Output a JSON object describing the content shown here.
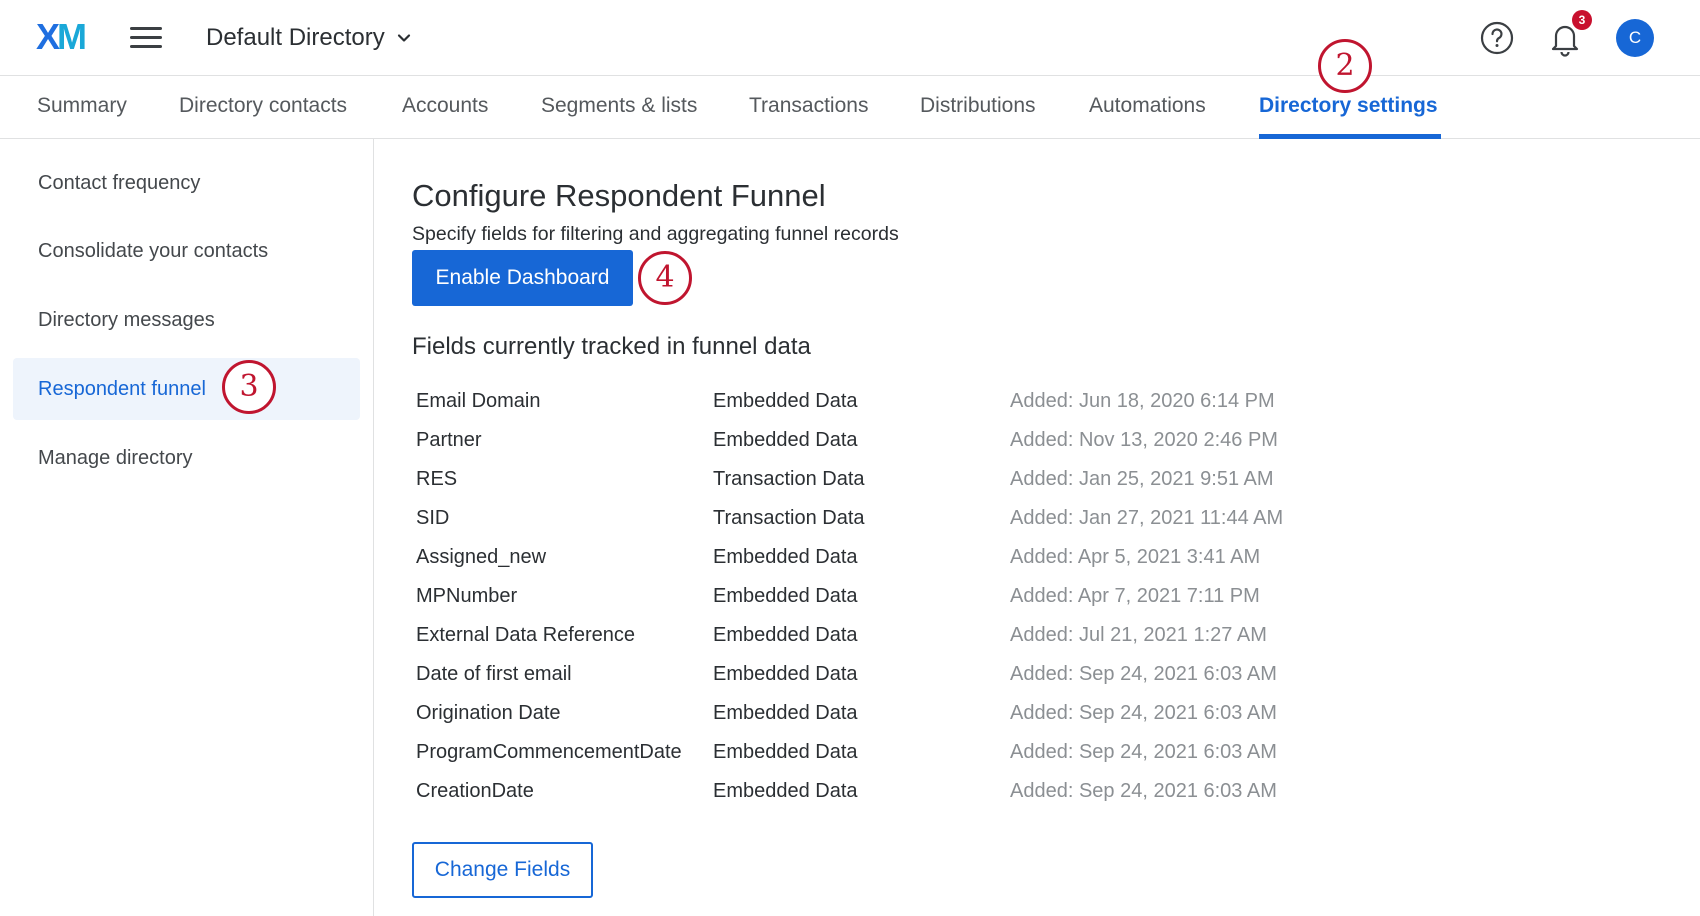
{
  "header": {
    "logo_x": "X",
    "logo_m": "M",
    "menu_icon": "hamburger-menu-icon",
    "directory_label": "Default Directory",
    "notification_count": "3",
    "avatar_initial": "C",
    "help_icon": "help-circle-icon",
    "bell_icon": "bell-icon"
  },
  "tabs": [
    {
      "label": "Summary"
    },
    {
      "label": "Directory contacts"
    },
    {
      "label": "Accounts"
    },
    {
      "label": "Segments & lists"
    },
    {
      "label": "Transactions"
    },
    {
      "label": "Distributions"
    },
    {
      "label": "Automations"
    },
    {
      "label": "Directory settings",
      "active": true
    }
  ],
  "callouts": {
    "tab": "2",
    "sidebar": "3",
    "button": "4"
  },
  "sidebar": {
    "items": [
      {
        "label": "Contact frequency"
      },
      {
        "label": "Consolidate your contacts"
      },
      {
        "label": "Directory messages"
      },
      {
        "label": "Respondent funnel",
        "active": true
      },
      {
        "label": "Manage directory"
      }
    ]
  },
  "main": {
    "title": "Configure Respondent Funnel",
    "subtitle": "Specify fields for filtering and aggregating funnel records",
    "enable_button": "Enable Dashboard",
    "section_title": "Fields currently tracked in funnel data",
    "fields": [
      {
        "name": "Email Domain",
        "type": "Embedded Data",
        "added": "Added: Jun 18, 2020 6:14 PM"
      },
      {
        "name": "Partner",
        "type": "Embedded Data",
        "added": "Added: Nov 13, 2020 2:46 PM"
      },
      {
        "name": "RES",
        "type": "Transaction Data",
        "added": "Added: Jan 25, 2021 9:51 AM"
      },
      {
        "name": "SID",
        "type": "Transaction Data",
        "added": "Added: Jan 27, 2021 11:44 AM"
      },
      {
        "name": "Assigned_new",
        "type": "Embedded Data",
        "added": "Added: Apr 5, 2021 3:41 AM"
      },
      {
        "name": "MPNumber",
        "type": "Embedded Data",
        "added": "Added: Apr 7, 2021 7:11 PM"
      },
      {
        "name": "External Data Reference",
        "type": "Embedded Data",
        "added": "Added: Jul 21, 2021 1:27 AM"
      },
      {
        "name": "Date of first email",
        "type": "Embedded Data",
        "added": "Added: Sep 24, 2021 6:03 AM"
      },
      {
        "name": "Origination Date",
        "type": "Embedded Data",
        "added": "Added: Sep 24, 2021 6:03 AM"
      },
      {
        "name": "ProgramCommencementDate",
        "type": "Embedded Data",
        "added": "Added: Sep 24, 2021 6:03 AM"
      },
      {
        "name": "CreationDate",
        "type": "Embedded Data",
        "added": "Added: Sep 24, 2021 6:03 AM"
      }
    ],
    "change_button": "Change Fields"
  },
  "colors": {
    "accent": "#1767d6",
    "callout": "#c0152f",
    "active_bg": "#eef4fc",
    "muted_text": "#8b8f93"
  }
}
